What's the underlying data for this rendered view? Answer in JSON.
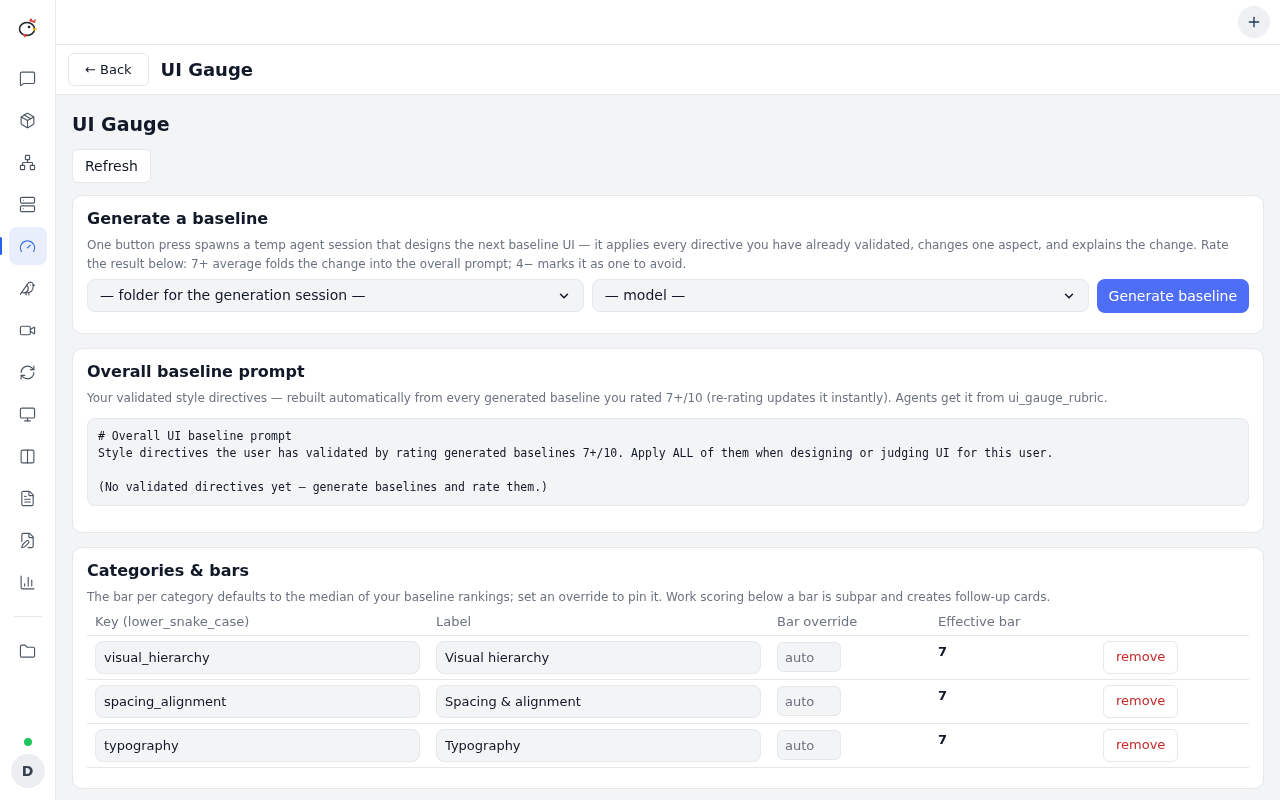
{
  "sidebar": {
    "items": [
      {
        "kind": "chat",
        "selected": false
      },
      {
        "kind": "package",
        "selected": false
      },
      {
        "kind": "network",
        "selected": false
      },
      {
        "kind": "server",
        "selected": false
      },
      {
        "kind": "gauge",
        "selected": true
      },
      {
        "kind": "bird",
        "selected": false
      },
      {
        "kind": "video",
        "selected": false
      },
      {
        "kind": "sync",
        "selected": false
      },
      {
        "kind": "monitor",
        "selected": false
      },
      {
        "kind": "columns",
        "selected": false
      },
      {
        "kind": "file",
        "selected": false
      },
      {
        "kind": "file-edit",
        "selected": false
      },
      {
        "kind": "chart",
        "selected": false
      }
    ],
    "bottom_items": [
      {
        "kind": "folder",
        "selected": false
      }
    ],
    "user": {
      "online": true,
      "initial": "D"
    }
  },
  "header": {
    "back": "← Back",
    "title": "UI Gauge"
  },
  "page": {
    "title": "UI Gauge",
    "refresh": "Refresh"
  },
  "generate": {
    "title": "Generate a baseline",
    "description": "One button press spawns a temp agent session that designs the next baseline UI — it applies every directive you have already validated, changes one aspect, and explains the change. Rate the result below: 7+ average folds the change into the overall prompt; 4− marks it as one to avoid.",
    "folder_select": "— folder for the generation session —",
    "model_select": "— model —",
    "button": "Generate baseline"
  },
  "overall": {
    "title": "Overall baseline prompt",
    "description": "Your validated style directives — rebuilt automatically from every generated baseline you rated 7+/10 (re-rating updates it instantly). Agents get it from ui_gauge_rubric.",
    "code_paragraphs": [
      [
        "# Overall UI baseline prompt",
        "Style directives the user has validated by rating generated baselines 7+/10. Apply ALL of them when designing or judging UI for this user."
      ],
      [
        "(No validated directives yet — generate baselines and rate them.)"
      ]
    ]
  },
  "categories": {
    "title": "Categories & bars",
    "description": "The bar per category defaults to the median of your baseline rankings; set an override to pin it. Work scoring below a bar is subpar and creates follow-up cards.",
    "columns": [
      "Key (lower_snake_case)",
      "Label",
      "Bar override",
      "Effective bar"
    ],
    "rows": [
      {
        "key": "visual_hierarchy",
        "label": "Visual hierarchy",
        "override_placeholder": "auto",
        "effective": "7",
        "action": "remove"
      },
      {
        "key": "spacing_alignment",
        "label": "Spacing & alignment",
        "override_placeholder": "auto",
        "effective": "7",
        "action": "remove"
      },
      {
        "key": "typography",
        "label": "Typography",
        "override_placeholder": "auto",
        "effective": "7",
        "action": "remove"
      }
    ]
  }
}
